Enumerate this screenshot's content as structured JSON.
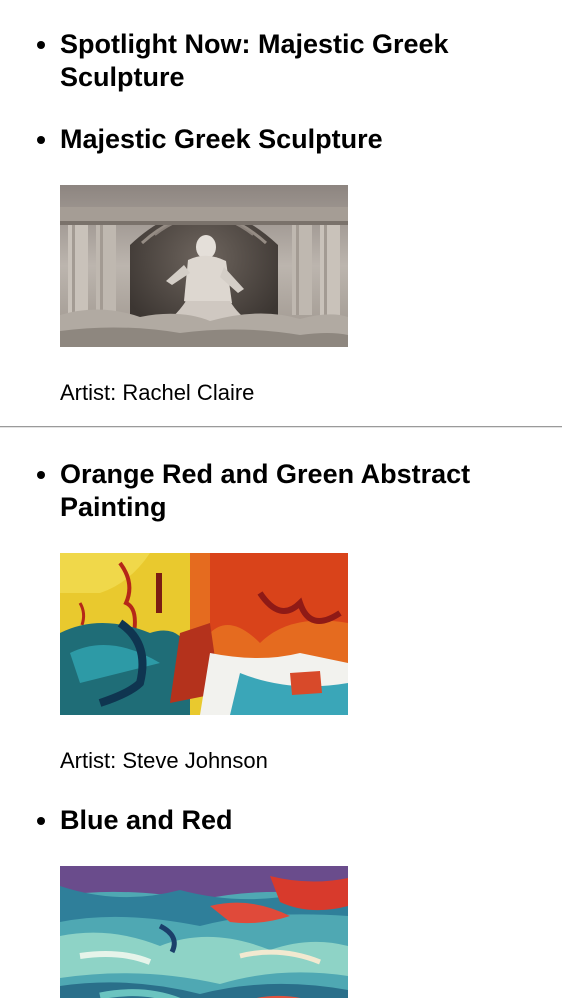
{
  "spotlight": {
    "heading": "Spotlight Now: Majestic Greek Sculpture"
  },
  "artworks": [
    {
      "title": "Majestic Greek Sculpture",
      "artist": "Artist: Rachel Claire",
      "image_icon": "greek-sculpture-fountain-photo"
    },
    {
      "title": "Orange Red and Green Abstract Painting",
      "artist": "Artist: Steve Johnson",
      "image_icon": "orange-red-green-abstract-painting"
    },
    {
      "title": "Blue and Red",
      "image_icon": "blue-red-abstract-painting"
    }
  ]
}
